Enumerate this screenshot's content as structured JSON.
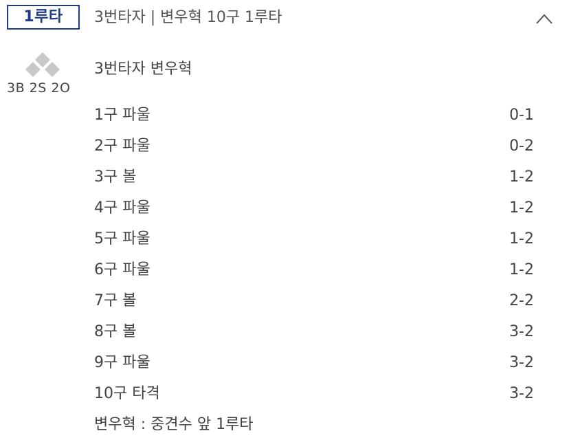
{
  "header": {
    "result_badge": "1루타",
    "title": "3번타자 | 변우혁 10구 1루타",
    "collapse_icon": "chevron-up-icon"
  },
  "count_indicator": {
    "bases_icon": "base-diamond-icon",
    "runners": {
      "first": false,
      "second": false,
      "third": false
    },
    "text": "3B 2S 2O"
  },
  "batter": {
    "name": "3번타자 변우혁"
  },
  "pitches": [
    {
      "label": "1구 파울",
      "count": "0-1"
    },
    {
      "label": "2구 파울",
      "count": "0-2"
    },
    {
      "label": "3구 볼",
      "count": "1-2"
    },
    {
      "label": "4구 파울",
      "count": "1-2"
    },
    {
      "label": "5구 파울",
      "count": "1-2"
    },
    {
      "label": "6구 파울",
      "count": "1-2"
    },
    {
      "label": "7구 볼",
      "count": "2-2"
    },
    {
      "label": "8구 볼",
      "count": "3-2"
    },
    {
      "label": "9구 파울",
      "count": "3-2"
    },
    {
      "label": "10구 타격",
      "count": "3-2"
    }
  ],
  "result": {
    "text": "변우혁 : 중견수 앞 1루타"
  },
  "colors": {
    "accent": "#1f3a8a",
    "text": "#444444",
    "base_empty": "#c8c8c8"
  }
}
